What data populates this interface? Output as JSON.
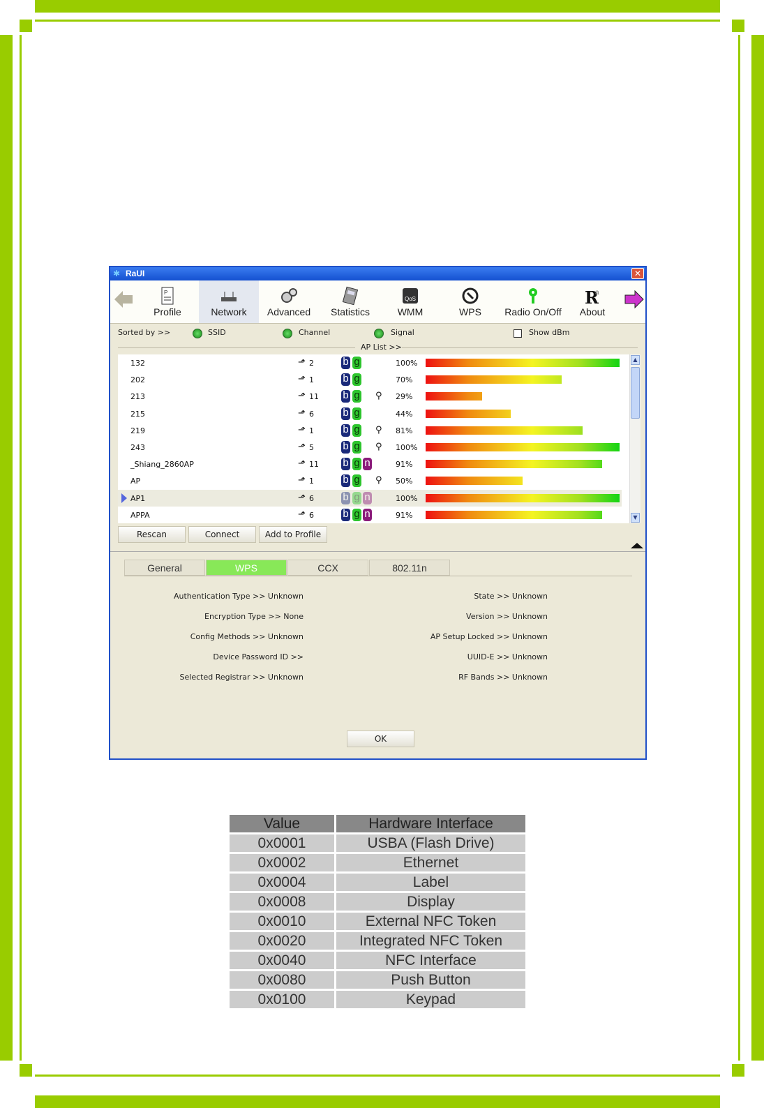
{
  "window": {
    "title": "RaUI",
    "close_glyph": "✕"
  },
  "toolbar": {
    "items": [
      {
        "label": "Profile",
        "icon": "profile-icon"
      },
      {
        "label": "Network",
        "icon": "network-icon"
      },
      {
        "label": "Advanced",
        "icon": "advanced-icon"
      },
      {
        "label": "Statistics",
        "icon": "statistics-icon"
      },
      {
        "label": "WMM",
        "icon": "wmm-icon"
      },
      {
        "label": "WPS",
        "icon": "wps-icon"
      },
      {
        "label": "Radio On/Off",
        "icon": "radio-icon"
      },
      {
        "label": "About",
        "icon": "about-icon"
      }
    ],
    "active": "Network"
  },
  "sort": {
    "label": "Sorted by >>",
    "options": [
      "SSID",
      "Channel",
      "Signal"
    ],
    "show_dbm_label": "Show dBm",
    "show_dbm_checked": false
  },
  "ap_list": {
    "title": "AP List >>",
    "rows": [
      {
        "ssid": "132",
        "channel": "2",
        "modes": [
          "b",
          "g"
        ],
        "secured": false,
        "signal": "100%",
        "level": 1.0
      },
      {
        "ssid": "202",
        "channel": "1",
        "modes": [
          "b",
          "g"
        ],
        "secured": false,
        "signal": "70%",
        "level": 0.7
      },
      {
        "ssid": "213",
        "channel": "11",
        "modes": [
          "b",
          "g"
        ],
        "secured": true,
        "signal": "29%",
        "level": 0.29
      },
      {
        "ssid": "215",
        "channel": "6",
        "modes": [
          "b",
          "g"
        ],
        "secured": false,
        "signal": "44%",
        "level": 0.44
      },
      {
        "ssid": "219",
        "channel": "1",
        "modes": [
          "b",
          "g"
        ],
        "secured": true,
        "signal": "81%",
        "level": 0.81
      },
      {
        "ssid": "243",
        "channel": "5",
        "modes": [
          "b",
          "g"
        ],
        "secured": true,
        "signal": "100%",
        "level": 1.0
      },
      {
        "ssid": "_Shiang_2860AP",
        "channel": "11",
        "modes": [
          "b",
          "g",
          "n"
        ],
        "secured": false,
        "signal": "91%",
        "level": 0.91
      },
      {
        "ssid": "AP",
        "channel": "1",
        "modes": [
          "b",
          "g"
        ],
        "secured": true,
        "signal": "50%",
        "level": 0.5
      },
      {
        "ssid": "AP1",
        "channel": "6",
        "modes": [
          "b",
          "g",
          "n"
        ],
        "secured": false,
        "signal": "100%",
        "level": 1.0,
        "selected": true
      },
      {
        "ssid": "APPA",
        "channel": "6",
        "modes": [
          "b",
          "g",
          "n"
        ],
        "secured": false,
        "signal": "91%",
        "level": 0.91
      }
    ]
  },
  "buttons": {
    "rescan": "Rescan",
    "connect": "Connect",
    "add_to_profile": "Add to Profile",
    "ok": "OK"
  },
  "tabs": [
    "General",
    "WPS",
    "CCX",
    "802.11n"
  ],
  "active_tab": "WPS",
  "wps_info": {
    "left": [
      "Authentication Type >> Unknown",
      "Encryption Type >> None",
      "Config Methods >> Unknown",
      "Device Password ID >>",
      "Selected Registrar >> Unknown"
    ],
    "right": [
      "State >> Unknown",
      "Version >> Unknown",
      "AP Setup Locked >> Unknown",
      "UUID-E >> Unknown",
      "RF Bands >> Unknown"
    ]
  },
  "hw_table": {
    "headers": [
      "Value",
      "Hardware Interface"
    ],
    "rows": [
      [
        "0x0001",
        "USBA (Flash Drive)"
      ],
      [
        "0x0002",
        "Ethernet"
      ],
      [
        "0x0004",
        "Label"
      ],
      [
        "0x0008",
        "Display"
      ],
      [
        "0x0010",
        "External NFC Token"
      ],
      [
        "0x0020",
        "Integrated NFC Token"
      ],
      [
        "0x0040",
        "NFC Interface"
      ],
      [
        "0x0080",
        "Push Button"
      ],
      [
        "0x0100",
        "Keypad"
      ]
    ]
  },
  "colors": {
    "frame": "#99cc00",
    "titlebar": "#1450d0",
    "active_tab": "#88e858"
  }
}
